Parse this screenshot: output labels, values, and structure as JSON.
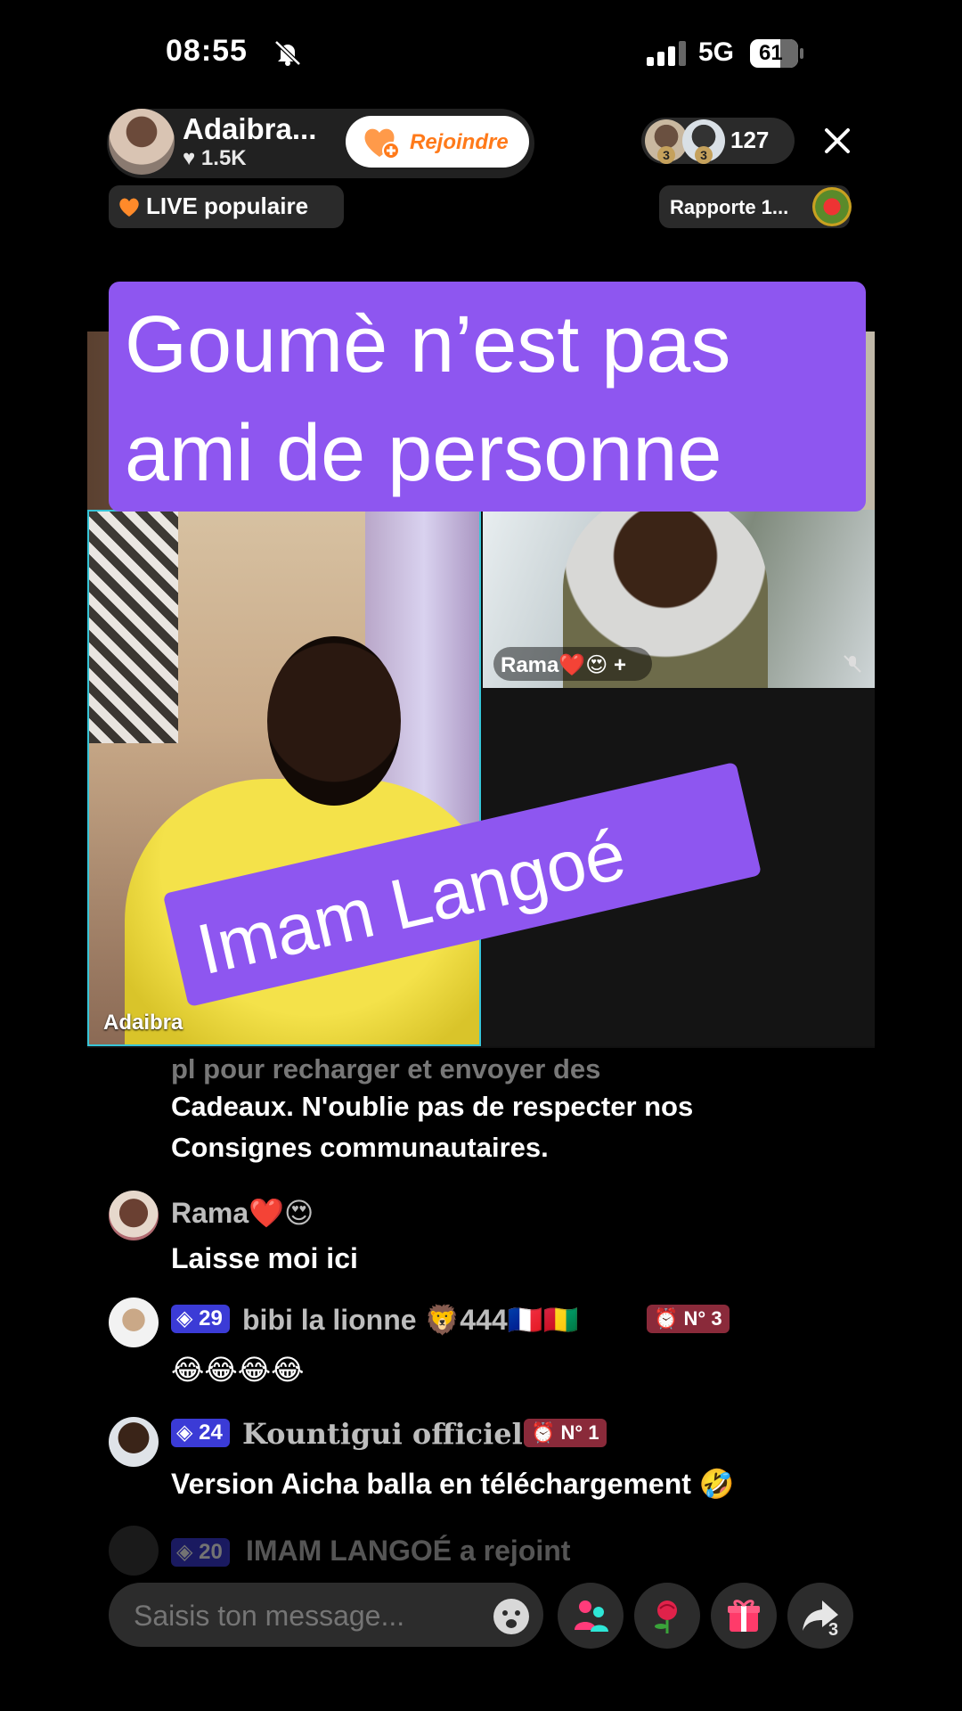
{
  "status_bar": {
    "time": "08:55",
    "network": "5G",
    "battery": "61"
  },
  "host": {
    "name": "Adaibra...",
    "likes": "1.5K",
    "join_label": "Rejoindre"
  },
  "viewers": {
    "count": "127",
    "rank1": "3",
    "rank2": "3"
  },
  "live_badge": "LIVE populaire",
  "report_label": "Rapporte 1...",
  "captions": {
    "top": "Goumè n’est pas ami de personne",
    "bottom": "Imam Langoé"
  },
  "video": {
    "left_name": "Adaibra",
    "right_top_name": "Rama❤️😍 +"
  },
  "chat": {
    "system_faded": "pl  pour recharger et envoyer des",
    "system_line1": "Cadeaux. N'oublie pas de respecter nos",
    "system_line2": "Consignes communautaires.",
    "messages": [
      {
        "user": "Rama❤️😍",
        "text": "Laisse moi ici"
      },
      {
        "level": "29",
        "user": "bibi la lionne 🦁444🇫🇷🇬🇳",
        "rank": "N° 3",
        "text": "😂😂😂😂"
      },
      {
        "level": "24",
        "user": "Kountigui officiel",
        "rank": "N° 1",
        "text": "Version Aicha balla en téléchargement 🤣"
      },
      {
        "level": "20",
        "user": "IMAM LANGOÉ a rejoint"
      }
    ]
  },
  "input": {
    "placeholder": "Saisis ton message..."
  },
  "share_count": "3",
  "colors": {
    "caption_purple": "#8e56f0",
    "accent_orange": "#ff7a1a",
    "level_badge": "#3b3bd6",
    "rank_badge": "#8a2a3a",
    "tile_border": "#38c5d8"
  },
  "icons": [
    "bell-slash-icon",
    "signal-icon",
    "battery-icon",
    "heart-plus-icon",
    "close-icon",
    "fire-heart-icon",
    "emoji-icon",
    "guests-icon",
    "rose-icon",
    "gift-icon",
    "share-icon"
  ]
}
